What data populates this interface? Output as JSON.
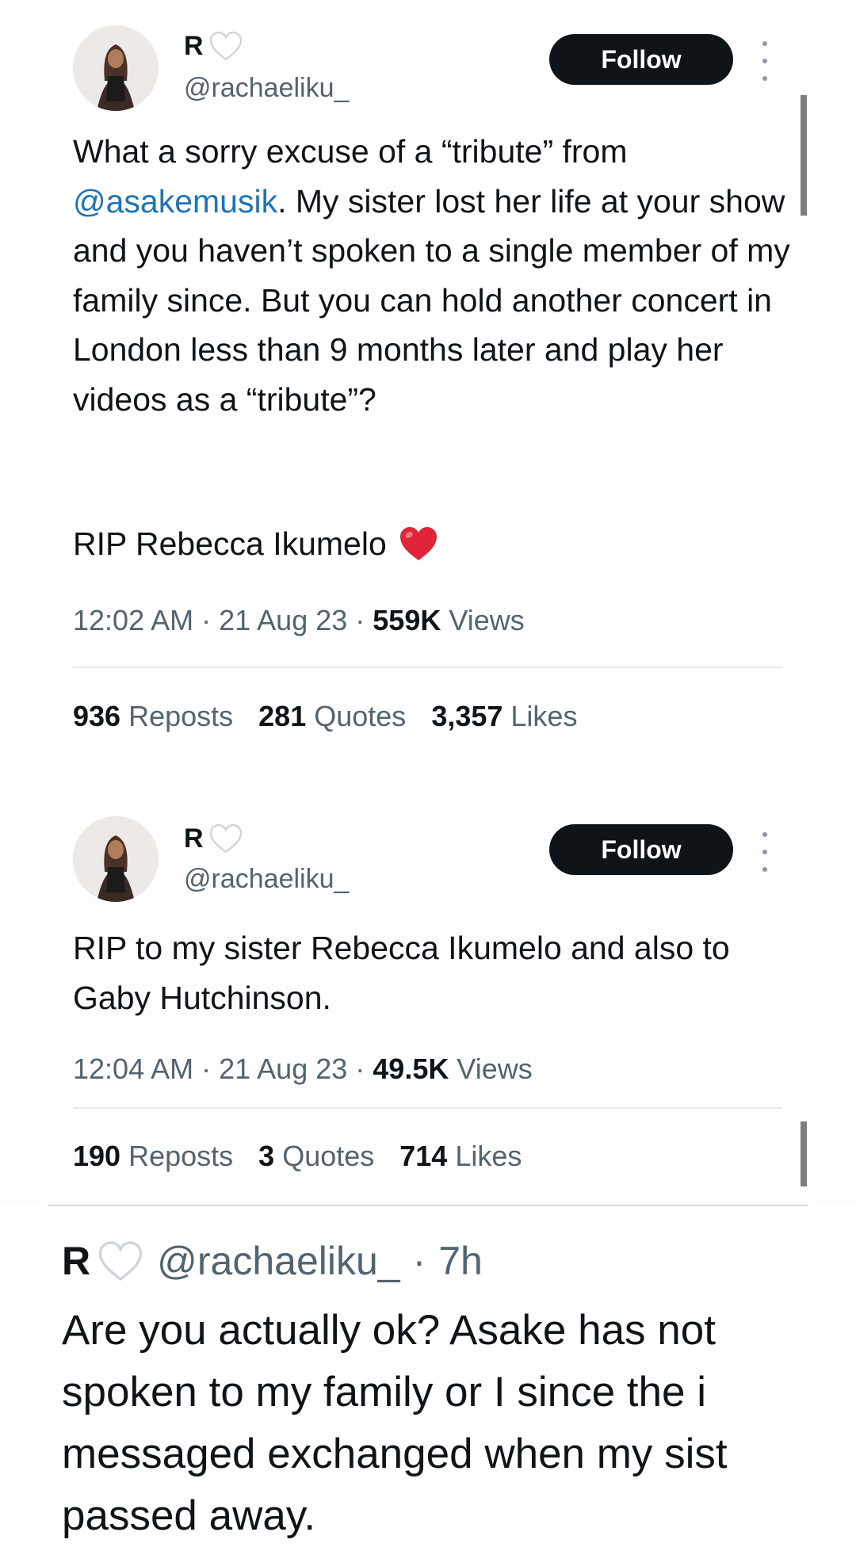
{
  "tweets": [
    {
      "author": {
        "display_name": "R",
        "handle": "@rachaeliku_"
      },
      "follow_label": "Follow",
      "body": {
        "before": "What a sorry excuse of a “tribute” from ",
        "mention": "@asakemusik",
        "after": ". My sister lost her life at your show and you haven’t spoken to a single member of my family since. But you can hold another concert in London less than 9 months later and play her videos as a “tribute”?",
        "rip": "RIP Rebecca Ikumelo"
      },
      "meta": {
        "time": "12:02 AM",
        "date": "21 Aug 23",
        "views_count": "559K",
        "views_label": "Views"
      },
      "stats": [
        {
          "count": "936",
          "label": "Reposts"
        },
        {
          "count": "281",
          "label": "Quotes"
        },
        {
          "count": "3,357",
          "label": "Likes"
        }
      ]
    },
    {
      "author": {
        "display_name": "R",
        "handle": "@rachaeliku_"
      },
      "follow_label": "Follow",
      "body": "RIP to my sister Rebecca Ikumelo and also to Gaby Hutchinson.",
      "meta": {
        "time": "12:04 AM",
        "date": "21 Aug 23",
        "views_count": "49.5K",
        "views_label": "Views"
      },
      "stats": [
        {
          "count": "190",
          "label": "Reposts"
        },
        {
          "count": "3",
          "label": "Quotes"
        },
        {
          "count": "714",
          "label": "Likes"
        }
      ]
    },
    {
      "author": {
        "display_name": "R",
        "handle": "@rachaeliku_"
      },
      "age": "7h",
      "body_lines": [
        "Are you actually ok? Asake has not",
        "spoken to my family or I since the i",
        "messaged exchanged when my sist",
        "passed away."
      ]
    }
  ],
  "icons": {
    "white_heart": "white-heart-emoji",
    "red_heart": "red-heart-emoji",
    "more": "more-vertical-icon"
  },
  "colors": {
    "text": "#0f1419",
    "secondary": "#536471",
    "mention": "#1d74b6",
    "follow_button": "#0f1419",
    "red_heart": "#e0243a"
  }
}
